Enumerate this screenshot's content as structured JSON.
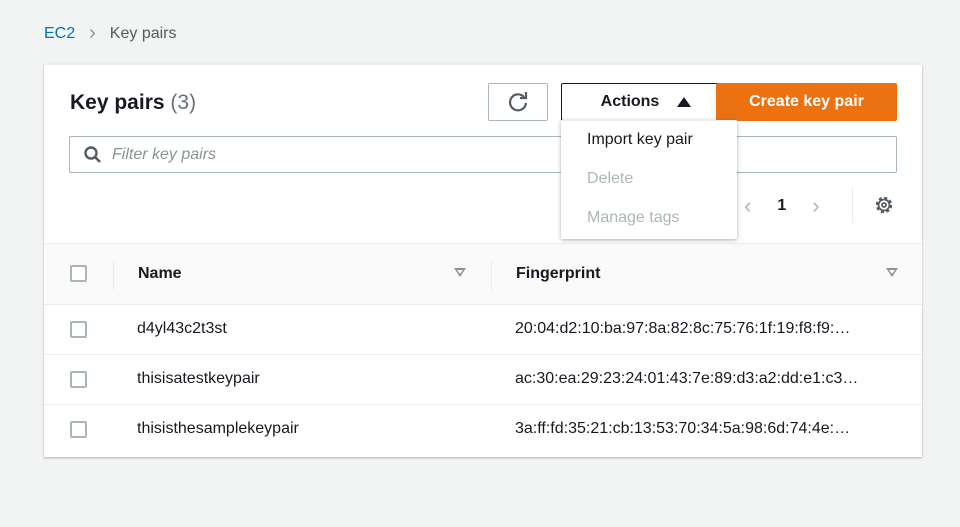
{
  "breadcrumb": {
    "parent": "EC2",
    "current": "Key pairs"
  },
  "header": {
    "title": "Key pairs",
    "count": "(3)",
    "actions_label": "Actions",
    "create_label": "Create key pair"
  },
  "filter": {
    "placeholder": "Filter key pairs"
  },
  "pagination": {
    "page": "1"
  },
  "actions_menu": [
    {
      "label": "Import key pair",
      "enabled": true
    },
    {
      "label": "Delete",
      "enabled": false
    },
    {
      "label": "Manage tags",
      "enabled": false
    }
  ],
  "table": {
    "columns": [
      "Name",
      "Fingerprint"
    ],
    "rows": [
      {
        "name": "d4yl43c2t3st",
        "fingerprint": "20:04:d2:10:ba:97:8a:82:8c:75:76:1f:19:f8:f9:…"
      },
      {
        "name": "thisisatestkeypair",
        "fingerprint": "ac:30:ea:29:23:24:01:43:7e:89:d3:a2:dd:e1:c3…"
      },
      {
        "name": "thisisthesamplekeypair",
        "fingerprint": "3a:ff:fd:35:21:cb:13:53:70:34:5a:98:6d:74:4e:…"
      }
    ]
  },
  "colors": {
    "accent": "#ec7211",
    "link": "#0073bb"
  }
}
